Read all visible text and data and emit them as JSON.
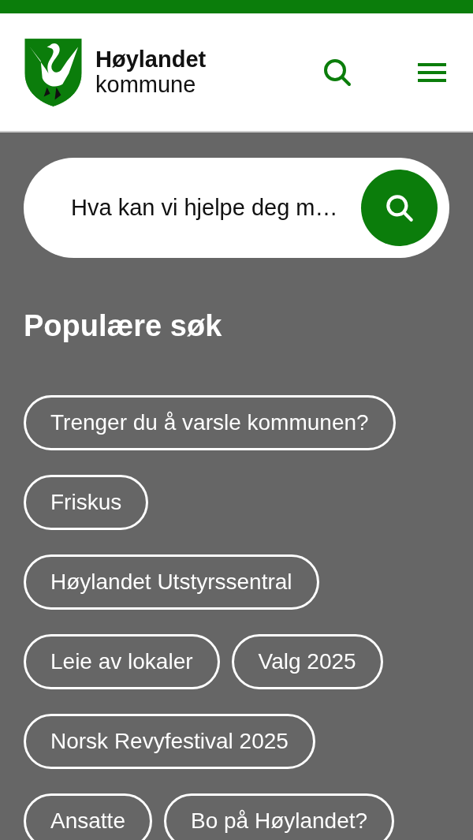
{
  "header": {
    "name": "Høylandet",
    "subtitle": "kommune"
  },
  "search": {
    "placeholder": "Hva kan vi hjelpe deg m…"
  },
  "popular": {
    "title": "Populære søk",
    "links": [
      {
        "label": "Trenger du å varsle kommunen?"
      },
      {
        "label": "Friskus"
      },
      {
        "label": "Høylandet Utstyrssentral"
      },
      {
        "label": "Leie av lokaler"
      },
      {
        "label": "Valg 2025"
      },
      {
        "label": "Norsk Revyfestival 2025"
      },
      {
        "label": "Ansatte"
      },
      {
        "label": "Bo på Høylandet?"
      }
    ]
  }
}
